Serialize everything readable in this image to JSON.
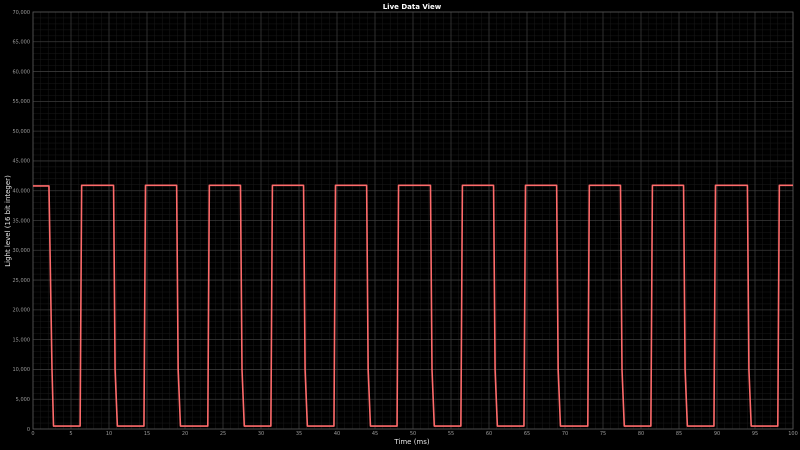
{
  "window": {
    "title": "Live Data View"
  },
  "chart_data": {
    "type": "line",
    "title": "Live Data View",
    "xlabel": "Time (ms)",
    "ylabel": "Light level (16 bit integer)",
    "xlim": [
      0,
      100
    ],
    "ylim": [
      0,
      70000
    ],
    "xticks": [
      0,
      5,
      10,
      15,
      20,
      25,
      30,
      35,
      40,
      45,
      50,
      55,
      60,
      65,
      70,
      75,
      80,
      85,
      90,
      95,
      100
    ],
    "xtick_labels": [
      "0",
      "5",
      "10",
      "15",
      "20",
      "25",
      "30",
      "35",
      "40",
      "45",
      "50",
      "55",
      "60",
      "65",
      "70",
      "75",
      "80",
      "85",
      "90",
      "95",
      "100"
    ],
    "yticks": [
      0,
      5000,
      10000,
      15000,
      20000,
      25000,
      30000,
      35000,
      40000,
      45000,
      50000,
      55000,
      60000,
      65000,
      70000
    ],
    "ytick_labels": [
      "0",
      "5,000",
      "10,000",
      "15,000",
      "20,000",
      "25,000",
      "30,000",
      "35,000",
      "40,000",
      "45,000",
      "50,000",
      "55,000",
      "60,000",
      "65,000",
      "70,000"
    ],
    "grid": true,
    "legend": "none",
    "line_color": "#ff6b6b",
    "background": "#000000",
    "grid_color": "#3a3a3a",
    "series": [
      {
        "x": [
          0,
          2.1,
          2.5,
          2.7,
          6.2,
          6.4,
          6.7,
          10.6,
          10.8,
          11.1,
          14.6,
          14.8,
          15.1,
          18.9,
          19.1,
          19.4,
          23.0,
          23.2,
          23.5,
          27.3,
          27.5,
          27.8,
          31.3,
          31.5,
          31.8,
          35.6,
          35.8,
          36.1,
          39.6,
          39.8,
          40.1,
          43.9,
          44.1,
          44.4,
          47.9,
          48.1,
          48.4,
          52.3,
          52.5,
          52.8,
          56.3,
          56.5,
          56.8,
          60.6,
          60.8,
          61.1,
          64.6,
          64.8,
          65.1,
          68.9,
          69.1,
          69.4,
          73.0,
          73.2,
          73.5,
          77.3,
          77.5,
          77.8,
          81.3,
          81.5,
          81.8,
          85.6,
          85.8,
          86.1,
          89.6,
          89.8,
          90.1,
          94.0,
          94.2,
          94.5,
          98.0,
          98.2,
          98.5,
          100
        ],
        "y": [
          40800,
          40800,
          10000,
          500,
          500,
          40900,
          40900,
          40900,
          10000,
          500,
          500,
          40900,
          40900,
          40900,
          10000,
          500,
          500,
          40900,
          40900,
          40900,
          10000,
          500,
          500,
          40900,
          40900,
          40900,
          10000,
          500,
          500,
          40900,
          40900,
          40900,
          10000,
          500,
          500,
          40900,
          40900,
          40900,
          10000,
          500,
          500,
          40900,
          40900,
          40900,
          10000,
          500,
          500,
          40900,
          40900,
          40900,
          10000,
          500,
          500,
          40900,
          40900,
          40900,
          10000,
          500,
          500,
          40900,
          40900,
          40900,
          10000,
          500,
          500,
          40900,
          40900,
          40900,
          10000,
          500,
          500,
          40900,
          40900,
          40900
        ]
      }
    ]
  }
}
